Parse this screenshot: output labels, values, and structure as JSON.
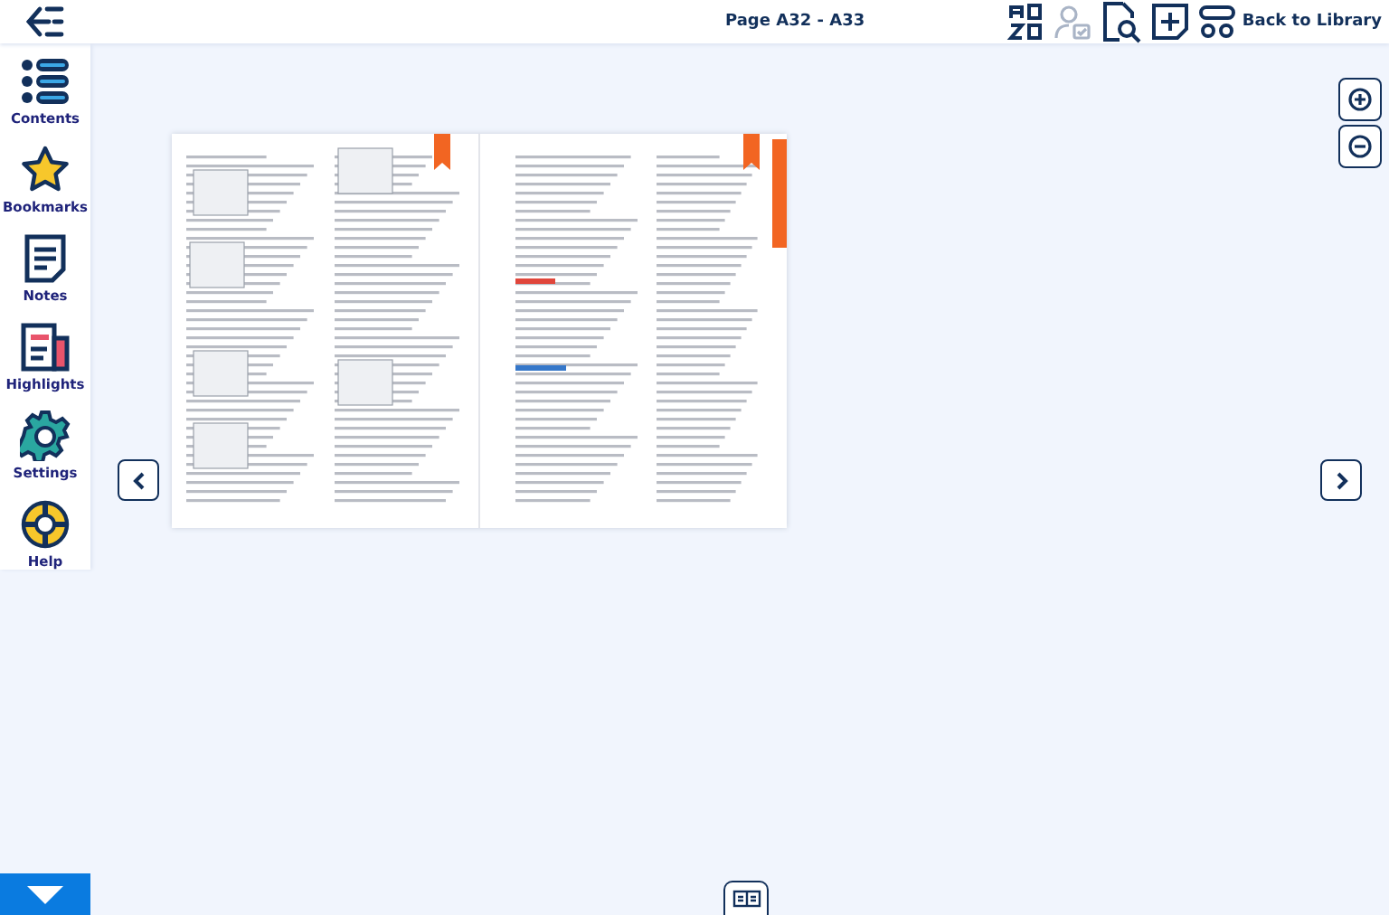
{
  "header": {
    "title": "Page A32 - A33",
    "back_link": "Back to Library"
  },
  "toolbar": [
    {
      "kind": "sort",
      "disabled": false
    },
    {
      "kind": "user",
      "disabled": true
    },
    {
      "kind": "search",
      "disabled": false
    },
    {
      "kind": "add",
      "disabled": false
    },
    {
      "kind": "layout",
      "disabled": false
    }
  ],
  "sidebar": {
    "items": [
      {
        "kind": "contents",
        "label": "Contents"
      },
      {
        "kind": "bookmarks",
        "label": "Bookmarks"
      },
      {
        "kind": "notes",
        "label": "Notes"
      },
      {
        "kind": "highlights",
        "label": "Highlights"
      },
      {
        "kind": "settings",
        "label": "Settings"
      },
      {
        "kind": "help",
        "label": "Help"
      }
    ]
  }
}
